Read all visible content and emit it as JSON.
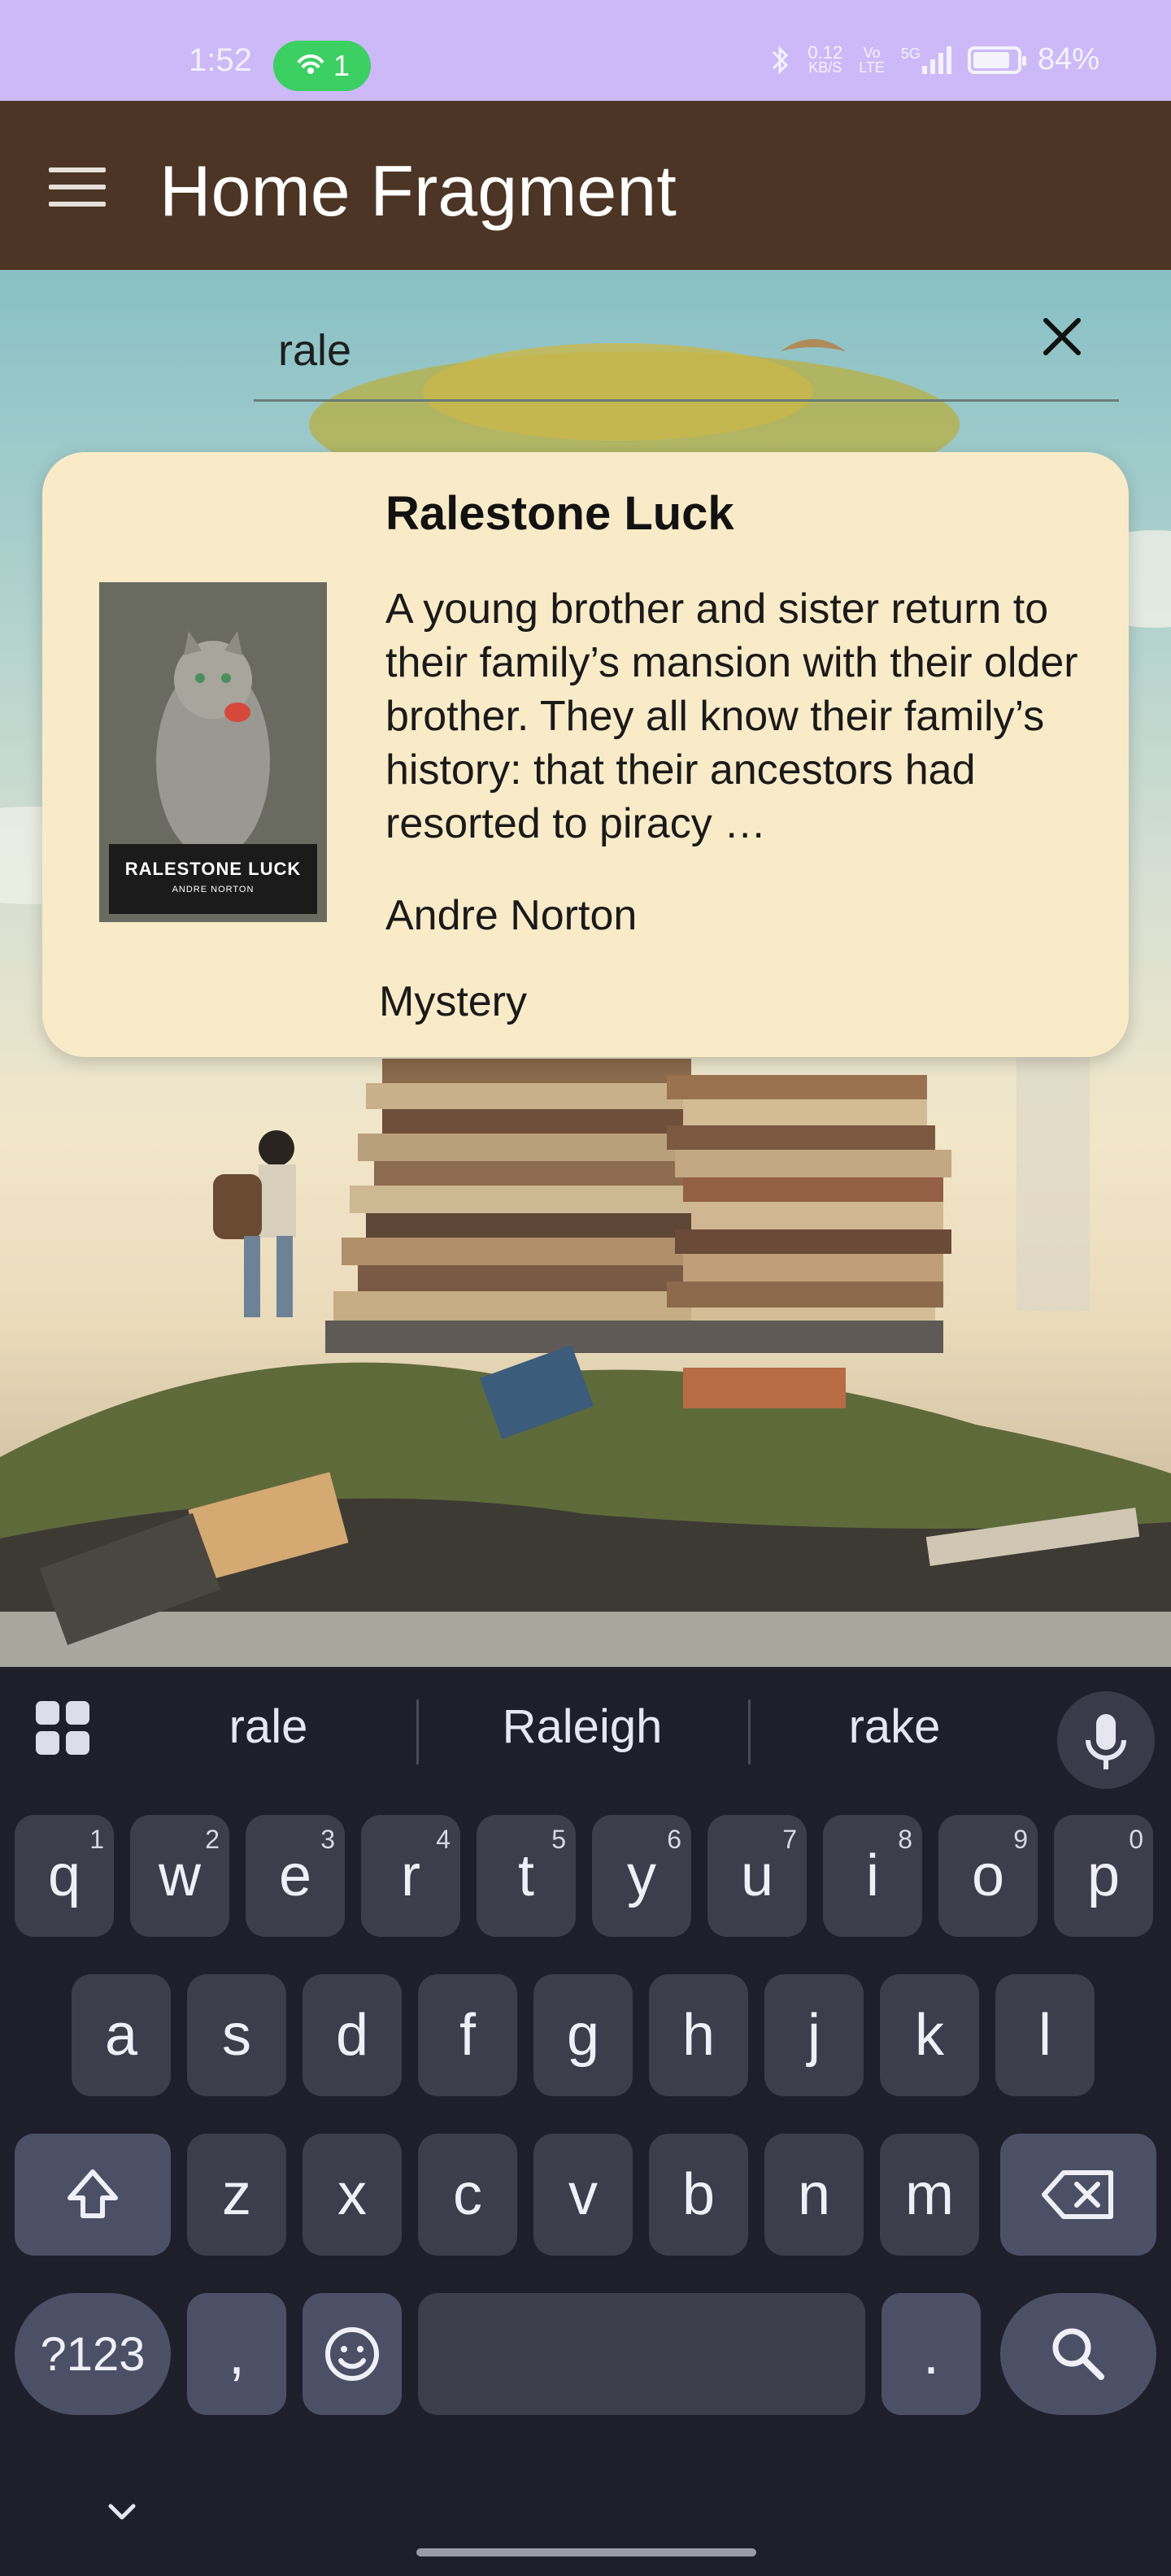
{
  "status_bar": {
    "time": "1:52",
    "hotspot_count": "1",
    "net_speed_top": "0.12",
    "net_speed_bottom": "KB/S",
    "volte_top": "Vo",
    "volte_bottom": "LTE",
    "network": "5G",
    "battery": "84%",
    "battery_level": 0.84,
    "hotspot_color": "#3ccf62"
  },
  "app_bar": {
    "title": "Home Fragment",
    "menu_icon": "hamburger-menu-icon",
    "background": "#4c3524"
  },
  "search": {
    "value": "rale",
    "clear_icon": "close-icon"
  },
  "result": {
    "title": "Ralestone Luck",
    "description": "A young brother and sister return to their family’s mansion with their older brother. They all know their family’s history: that their ancestors had resorted to piracy …",
    "author": "Andre Norton",
    "genre": "Mystery",
    "cover_title": "RALESTONE LUCK",
    "cover_author": "ANDRE NORTON",
    "card_color": "#f9ebc8"
  },
  "keyboard": {
    "suggestions": [
      "rale",
      "Raleigh",
      "rake"
    ],
    "row1": [
      {
        "key": "q",
        "num": "1"
      },
      {
        "key": "w",
        "num": "2"
      },
      {
        "key": "e",
        "num": "3"
      },
      {
        "key": "r",
        "num": "4"
      },
      {
        "key": "t",
        "num": "5"
      },
      {
        "key": "y",
        "num": "6"
      },
      {
        "key": "u",
        "num": "7"
      },
      {
        "key": "i",
        "num": "8"
      },
      {
        "key": "o",
        "num": "9"
      },
      {
        "key": "p",
        "num": "0"
      }
    ],
    "row2": [
      "a",
      "s",
      "d",
      "f",
      "g",
      "h",
      "j",
      "k",
      "l"
    ],
    "row3": [
      "z",
      "x",
      "c",
      "v",
      "b",
      "n",
      "m"
    ],
    "symbols_label": "?123",
    "comma": ",",
    "period": ".",
    "background": "#1f1f2b",
    "key_color": "#3d3d4b"
  }
}
